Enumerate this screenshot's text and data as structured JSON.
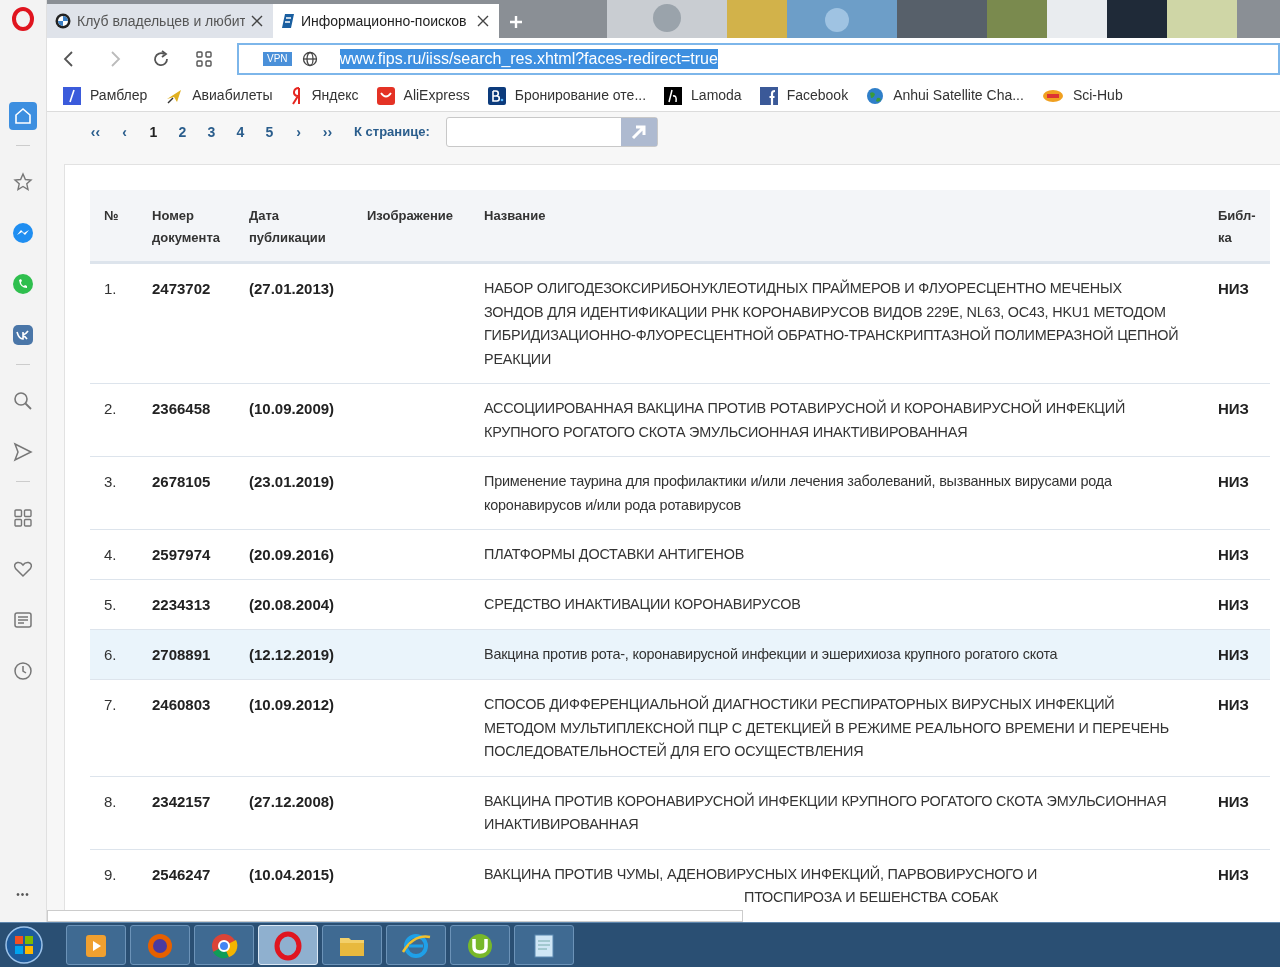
{
  "tabs": [
    {
      "title": "Клуб владельцев и любит",
      "selected": false,
      "kind": "bmw"
    },
    {
      "title": "Информационно-поисков",
      "selected": true,
      "kind": "fips"
    }
  ],
  "address": {
    "vpn": "VPN",
    "url": "www.fips.ru/iiss/search_res.xhtml?faces-redirect=true"
  },
  "bookmarks": [
    {
      "label": "Рамблер",
      "kind": "rambler"
    },
    {
      "label": "Авиабилеты",
      "kind": "plane"
    },
    {
      "label": "Яндекс",
      "kind": "yandex"
    },
    {
      "label": "AliExpress",
      "kind": "ali"
    },
    {
      "label": "Бронирование оте...",
      "kind": "booking"
    },
    {
      "label": "Lamoda",
      "kind": "lamoda"
    },
    {
      "label": "Facebook",
      "kind": "facebook"
    },
    {
      "label": "Anhui Satellite Cha...",
      "kind": "globe"
    },
    {
      "label": "Sci-Hub",
      "kind": "scihub"
    }
  ],
  "sidebar": [
    {
      "kind": "home",
      "selected": true
    },
    {
      "kind": "star",
      "selected": false
    },
    {
      "kind": "messenger",
      "selected": false
    },
    {
      "kind": "whatsapp",
      "selected": false
    },
    {
      "kind": "vk",
      "selected": false
    },
    {
      "kind": "search",
      "selected": false
    },
    {
      "kind": "send",
      "selected": false
    },
    {
      "kind": "grid",
      "selected": false
    },
    {
      "kind": "heart",
      "selected": false
    },
    {
      "kind": "news",
      "selected": false
    },
    {
      "kind": "clock",
      "selected": false
    }
  ],
  "sidebar_more": "•••",
  "pagination": {
    "first": "‹‹",
    "prev": "‹",
    "pages": [
      {
        "label": "1",
        "selected": true
      },
      {
        "label": "2",
        "selected": false
      },
      {
        "label": "3",
        "selected": false
      },
      {
        "label": "4",
        "selected": false
      },
      {
        "label": "5",
        "selected": false
      }
    ],
    "next": "›",
    "last": "››",
    "goto_label": "К странице:"
  },
  "table": {
    "columns": [
      [
        "№"
      ],
      [
        "Номер",
        "документа"
      ],
      [
        "Дата",
        "публикации"
      ],
      [
        "Изображение"
      ],
      [
        "Название"
      ],
      [
        "Библ-",
        "ка"
      ]
    ],
    "rows": [
      {
        "no": "1.",
        "number": "2473702",
        "date": "(27.01.2013)",
        "title_lines": [
          "НАБОР ОЛИГОДЕЗОКСИРИБОНУКЛЕОТИДНЫХ ПРАЙМЕРОВ И ФЛУОРЕСЦЕНТНО МЕЧЕНЫХ",
          "ЗОНДОВ ДЛЯ ИДЕНТИФИКАЦИИ РНК КОРОНАВИРУСОВ ВИДОВ 229E, NL63, OC43, HKU1 МЕТОДОМ",
          "ГИБРИДИЗАЦИОННО-ФЛУОРЕСЦЕНТНОЙ ОБРАТНО-ТРАНСКРИПТАЗНОЙ ПОЛИМЕРАЗНОЙ ЦЕПНОЙ",
          "РЕАКЦИИ"
        ],
        "library": "НИЗ",
        "highlighted": false
      },
      {
        "no": "2.",
        "number": "2366458",
        "date": "(10.09.2009)",
        "title_lines": [
          "АССОЦИИРОВАННАЯ ВАКЦИНА ПРОТИВ РОТАВИРУСНОЙ И КОРОНАВИРУСНОЙ ИНФЕКЦИЙ",
          "КРУПНОГО РОГАТОГО СКОТА ЭМУЛЬСИОННАЯ ИНАКТИВИРОВАННАЯ"
        ],
        "library": "НИЗ",
        "highlighted": false
      },
      {
        "no": "3.",
        "number": "2678105",
        "date": "(23.01.2019)",
        "title_lines": [
          "Применение таурина для профилактики и/или лечения заболеваний, вызванных вирусами рода",
          "коронавирусов и/или рода ротавирусов"
        ],
        "library": "НИЗ",
        "highlighted": false
      },
      {
        "no": "4.",
        "number": "2597974",
        "date": "(20.09.2016)",
        "title_lines": [
          "ПЛАТФОРМЫ ДОСТАВКИ АНТИГЕНОВ"
        ],
        "library": "НИЗ",
        "highlighted": false
      },
      {
        "no": "5.",
        "number": "2234313",
        "date": "(20.08.2004)",
        "title_lines": [
          "СРЕДСТВО ИНАКТИВАЦИИ КОРОНАВИРУСОВ"
        ],
        "library": "НИЗ",
        "highlighted": false
      },
      {
        "no": "6.",
        "number": "2708891",
        "date": "(12.12.2019)",
        "title_lines": [
          "Вакцина против рота-, коронавирусной инфекции и эшерихиоза крупного рогатого скота"
        ],
        "library": "НИЗ",
        "highlighted": true
      },
      {
        "no": "7.",
        "number": "2460803",
        "date": "(10.09.2012)",
        "title_lines": [
          "СПОСОБ ДИФФЕРЕНЦИАЛЬНОЙ ДИАГНОСТИКИ РЕСПИРАТОРНЫХ ВИРУСНЫХ ИНФЕКЦИЙ",
          "МЕТОДОМ МУЛЬТИПЛЕКСНОЙ ПЦР С ДЕТЕКЦИЕЙ В РЕЖИМЕ РЕАЛЬНОГО ВРЕМЕНИ И ПЕРЕЧЕНЬ",
          "ПОСЛЕДОВАТЕЛЬНОСТЕЙ ДЛЯ ЕГО ОСУЩЕСТВЛЕНИЯ"
        ],
        "library": "НИЗ",
        "highlighted": false
      },
      {
        "no": "8.",
        "number": "2342157",
        "date": "(27.12.2008)",
        "title_lines": [
          "ВАКЦИНА ПРОТИВ КОРОНАВИРУСНОЙ ИНФЕКЦИИ КРУПНОГО РОГАТОГО СКОТА ЭМУЛЬСИОННАЯ",
          "ИНАКТИВИРОВАННАЯ"
        ],
        "library": "НИЗ",
        "highlighted": false
      },
      {
        "no": "9.",
        "number": "2546247",
        "date": "(10.04.2015)",
        "title_lines": [
          "ВАКЦИНА ПРОТИВ ЧУМЫ, АДЕНОВИРУСНЫХ ИНФЕКЦИЙ, ПАРВОВИРУСНОГО И"
        ],
        "title_tail": "ПТОСПИРОЗА И БЕШЕНСТВА СОБАК",
        "library": "НИЗ",
        "highlighted": false
      }
    ]
  },
  "taskbar": [
    {
      "kind": "player",
      "selected": false
    },
    {
      "kind": "firefox",
      "selected": false
    },
    {
      "kind": "chrome",
      "selected": false
    },
    {
      "kind": "opera",
      "selected": true
    },
    {
      "kind": "folder",
      "selected": false
    },
    {
      "kind": "ie",
      "selected": false
    },
    {
      "kind": "torrent",
      "selected": false
    },
    {
      "kind": "notepad",
      "selected": false
    }
  ]
}
